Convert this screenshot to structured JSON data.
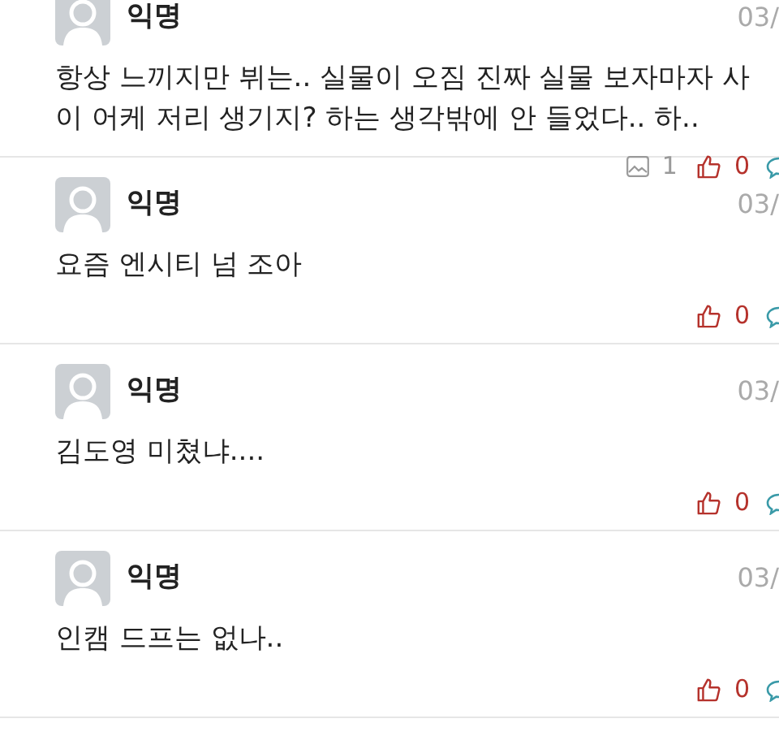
{
  "posts": [
    {
      "author": "익명",
      "date": "03/",
      "body_lines": [
        "항상 느끼지만 뷔는.. 실물이 오짐 진짜 실물 보자마자 사",
        "이 어케 저리 생기지? 하는 생각밖에 안 들었다.. 하.."
      ],
      "image_count": "1",
      "likes": "0"
    },
    {
      "author": "익명",
      "date": "03/",
      "body_lines": [
        "요즘 엔시티 넘 조아"
      ],
      "likes": "0"
    },
    {
      "author": "익명",
      "date": "03/",
      "body_lines": [
        "김도영 미쳤냐...."
      ],
      "likes": "0"
    },
    {
      "author": "익명",
      "date": "03/",
      "body_lines": [
        "인캠 드프는 없나.."
      ],
      "likes": "0"
    }
  ]
}
